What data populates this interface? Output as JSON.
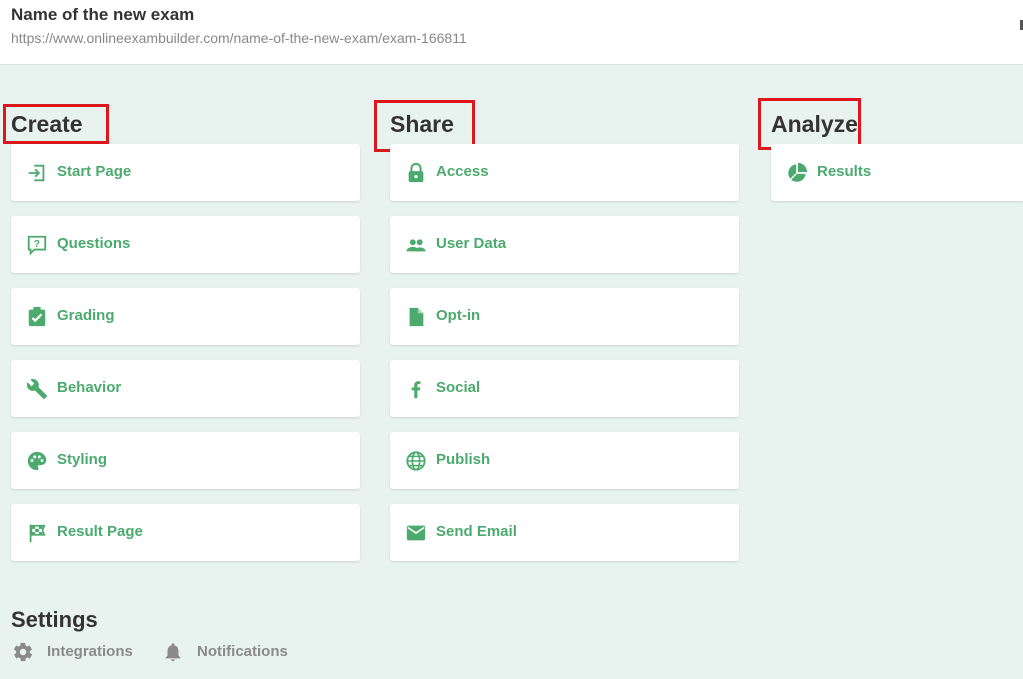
{
  "header": {
    "title": "Name of the new exam",
    "url": "https://www.onlineexambuilder.com/name-of-the-new-exam/exam-166811"
  },
  "sections": {
    "create": {
      "title": "Create",
      "items": [
        {
          "label": "Start Page",
          "icon": "login-arrow-icon"
        },
        {
          "label": "Questions",
          "icon": "question-bubble-icon"
        },
        {
          "label": "Grading",
          "icon": "clipboard-check-icon"
        },
        {
          "label": "Behavior",
          "icon": "wrench-icon"
        },
        {
          "label": "Styling",
          "icon": "palette-icon"
        },
        {
          "label": "Result Page",
          "icon": "checkered-flag-icon"
        }
      ]
    },
    "share": {
      "title": "Share",
      "items": [
        {
          "label": "Access",
          "icon": "lock-icon"
        },
        {
          "label": "User Data",
          "icon": "people-icon"
        },
        {
          "label": "Opt-in",
          "icon": "document-icon"
        },
        {
          "label": "Social",
          "icon": "facebook-icon"
        },
        {
          "label": "Publish",
          "icon": "globe-icon"
        },
        {
          "label": "Send Email",
          "icon": "envelope-icon"
        }
      ]
    },
    "analyze": {
      "title": "Analyze",
      "items": [
        {
          "label": "Results",
          "icon": "pie-chart-icon"
        }
      ]
    }
  },
  "settings": {
    "title": "Settings",
    "items": [
      {
        "label": "Integrations",
        "icon": "gear-icon"
      },
      {
        "label": "Notifications",
        "icon": "bell-icon"
      }
    ]
  },
  "colors": {
    "accent": "#4caa6e",
    "highlight": "#e0161e",
    "background": "#e8f2ee"
  }
}
